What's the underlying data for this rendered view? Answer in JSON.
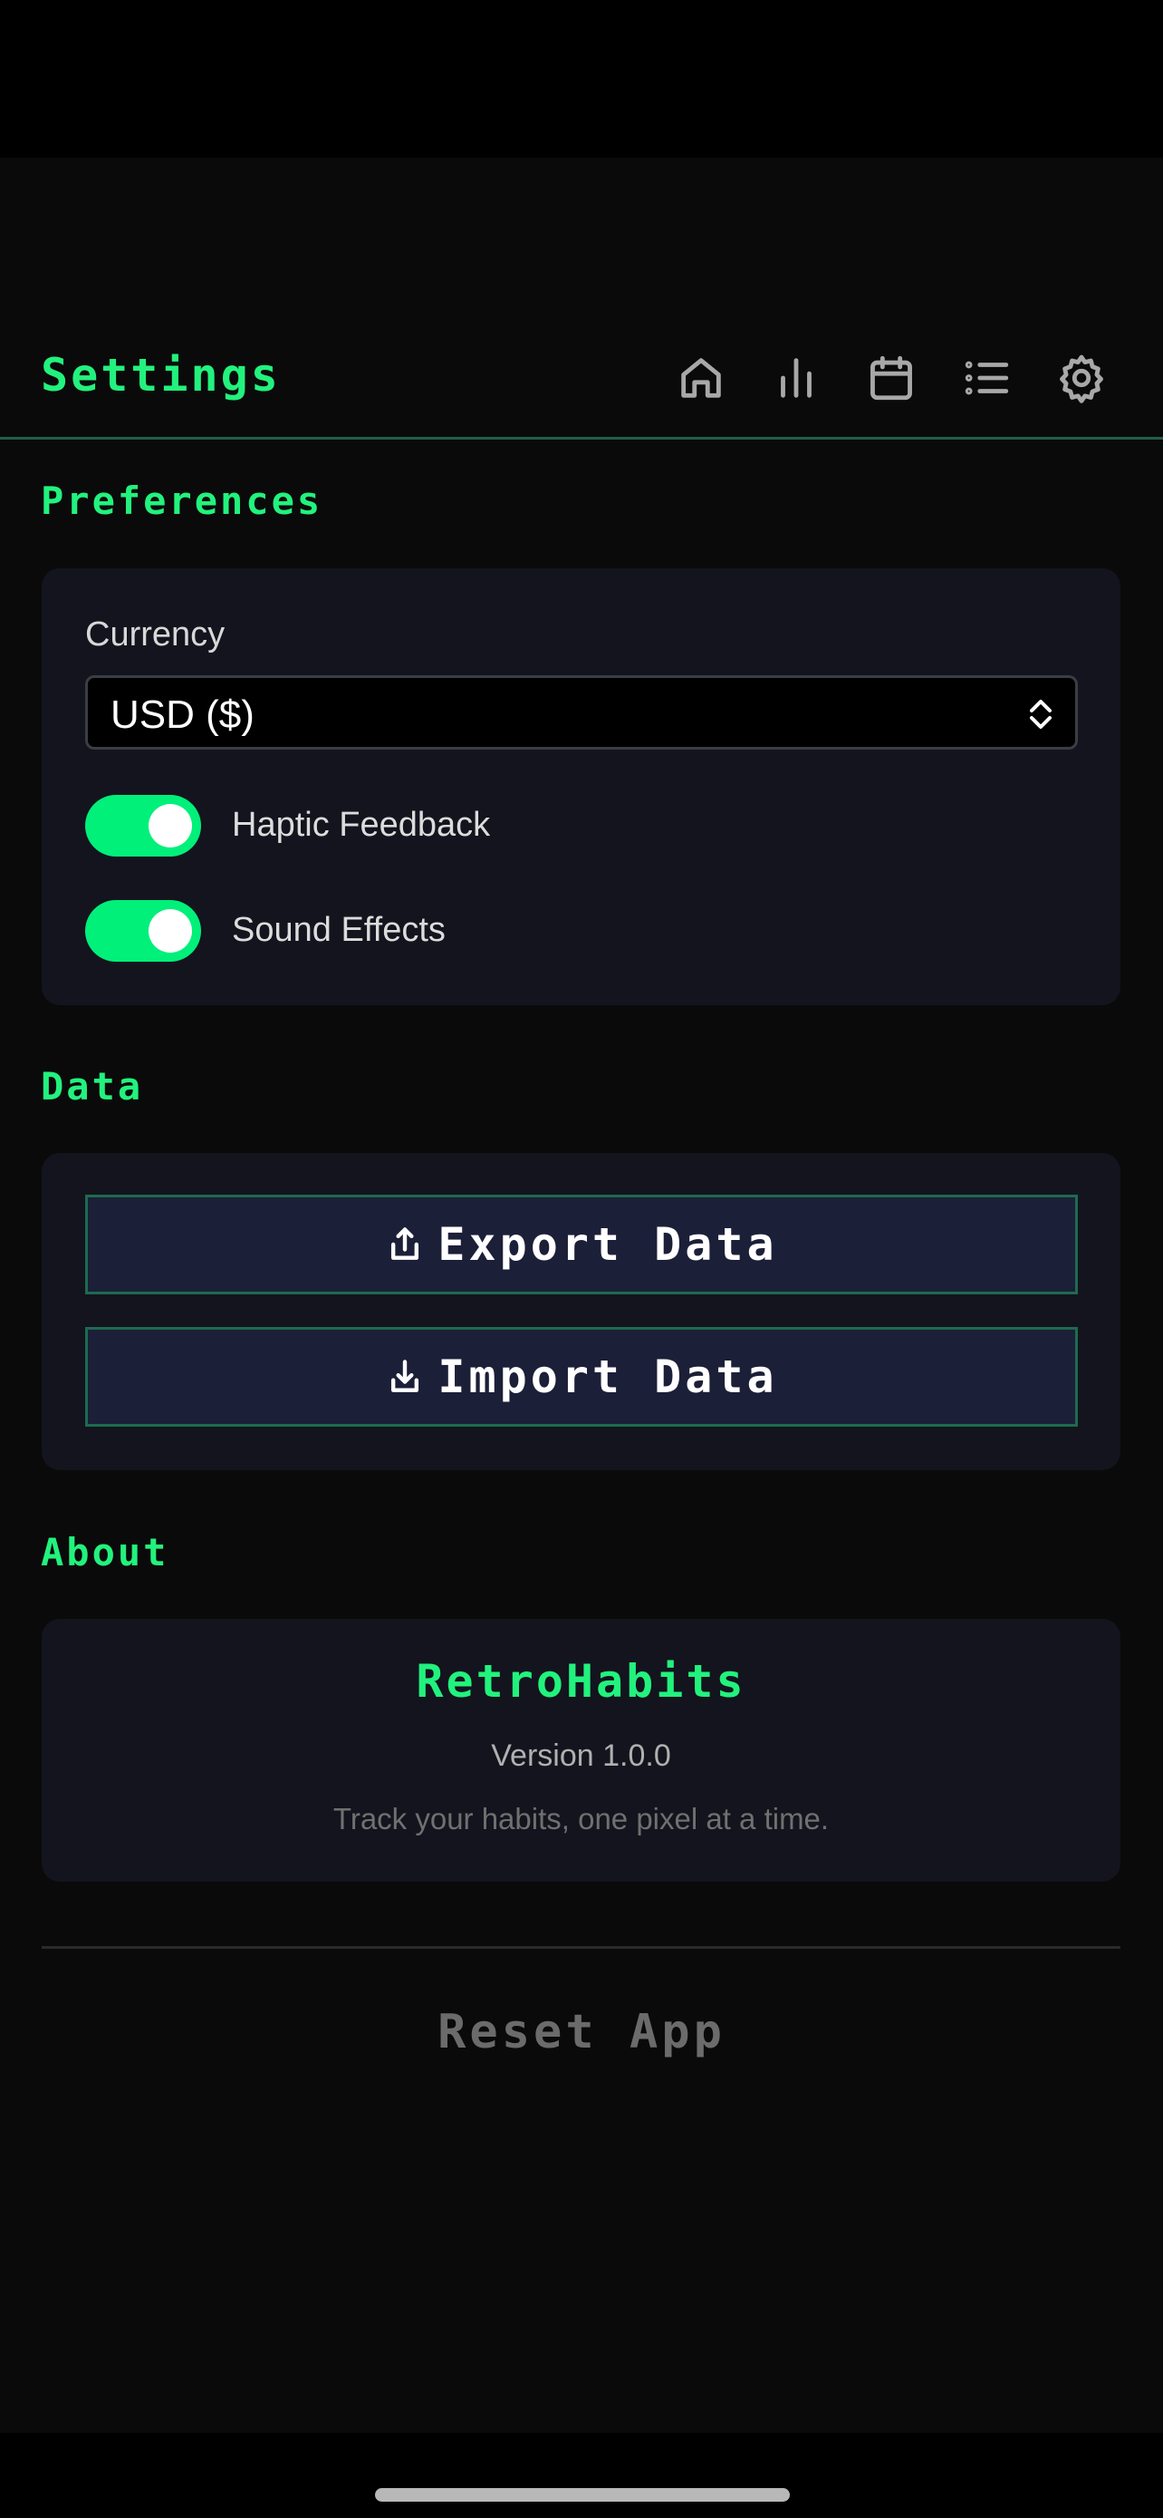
{
  "header": {
    "title": "Settings",
    "nav": [
      {
        "icon": "home-icon"
      },
      {
        "icon": "stats-icon"
      },
      {
        "icon": "calendar-icon"
      },
      {
        "icon": "list-icon"
      },
      {
        "icon": "gear-icon"
      }
    ]
  },
  "preferences": {
    "section_title": "Preferences",
    "currency_label": "Currency",
    "currency_value": "USD ($)",
    "haptic_label": "Haptic Feedback",
    "haptic_on": true,
    "sound_label": "Sound Effects",
    "sound_on": true
  },
  "data_section": {
    "section_title": "Data",
    "export_label": "Export Data",
    "import_label": "Import Data"
  },
  "about": {
    "section_title": "About",
    "app_name": "RetroHabits",
    "version": "Version 1.0.0",
    "tagline": "Track your habits, one pixel at a time."
  },
  "reset_label": "Reset App",
  "colors": {
    "accent": "#22f27d",
    "toggle_on": "#00f07a",
    "card": "#13141e",
    "button_bg": "#1c1f38",
    "button_border": "#1d6b4f"
  }
}
